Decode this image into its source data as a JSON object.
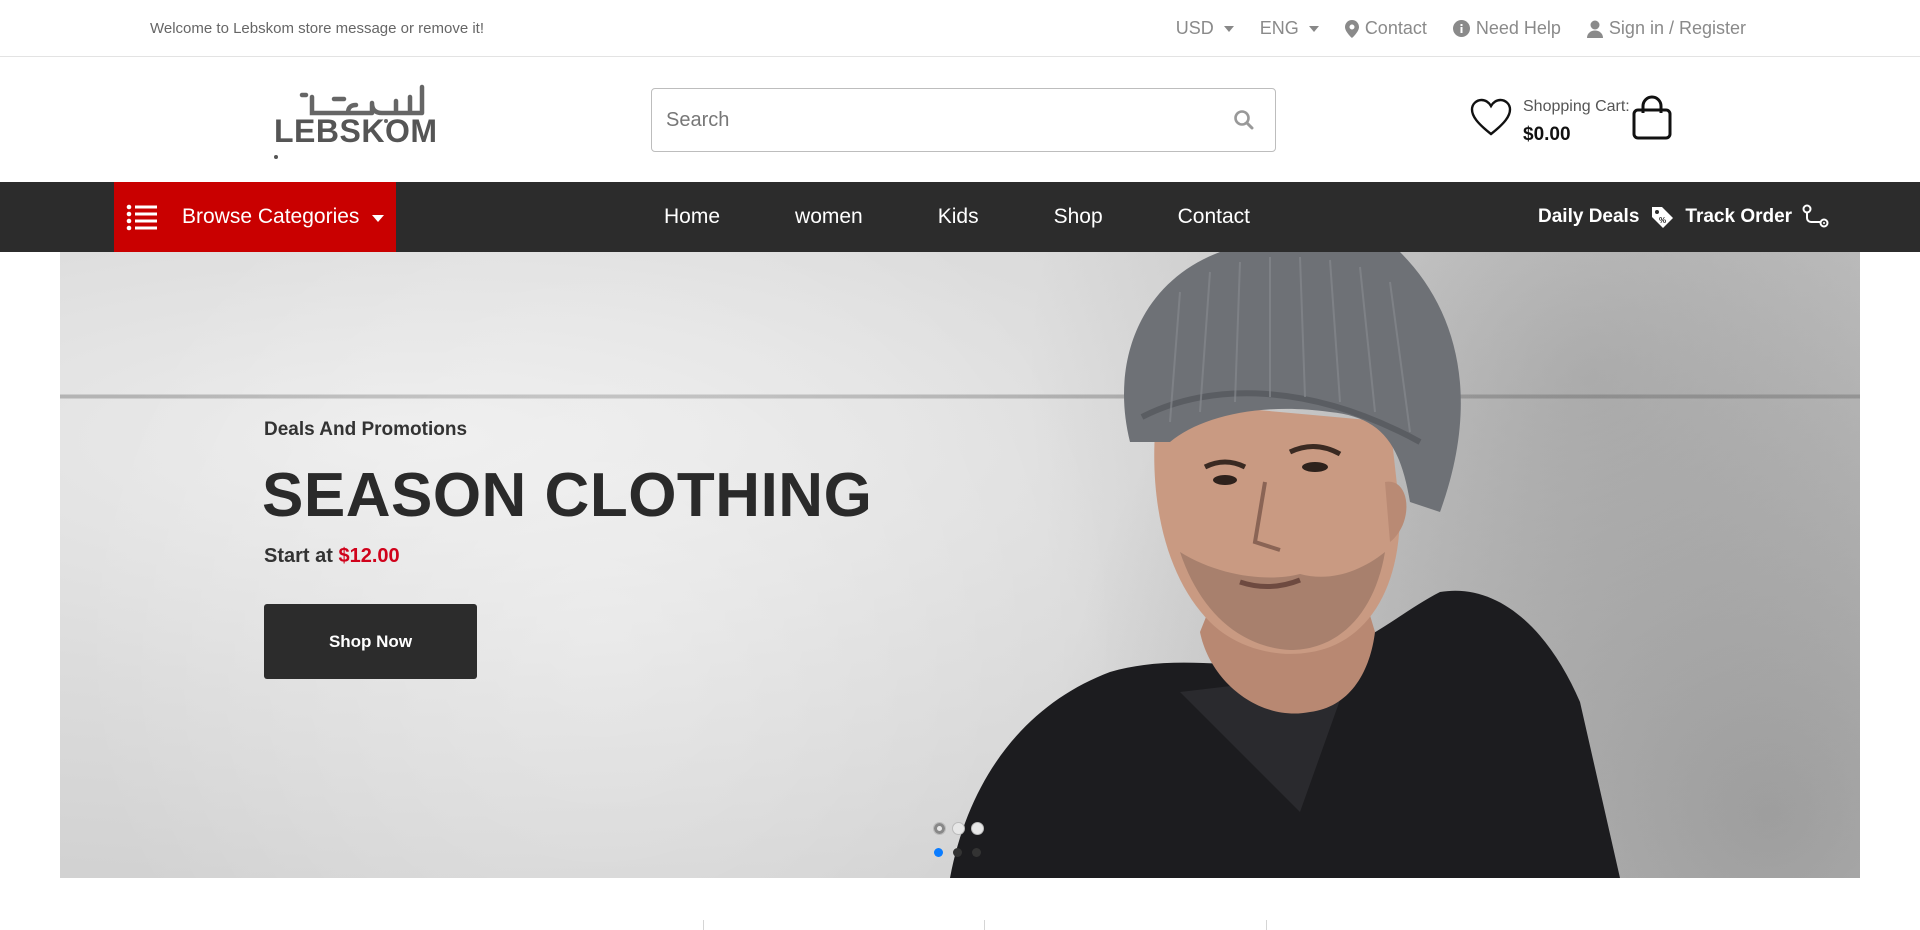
{
  "topbar": {
    "welcome": "Welcome to Lebskom store message or remove it!",
    "currency": "USD",
    "language": "ENG",
    "contact": "Contact",
    "help": "Need Help",
    "account": "Sign in / Register"
  },
  "header": {
    "logo_arabic": "لبسكم",
    "logo_text": "LEBSKOM",
    "search_placeholder": "Search",
    "cart_label": "Shopping Cart:",
    "cart_total": "$0.00"
  },
  "nav": {
    "browse": "Browse Categories",
    "links": [
      "Home",
      "women",
      "Kids",
      "Shop",
      "Contact"
    ],
    "daily_deals": "Daily Deals",
    "track_order": "Track Order"
  },
  "hero": {
    "kicker": "Deals And Promotions",
    "title": "SEASON CLOTHING",
    "price_prefix": "Start at",
    "price": "$12.00",
    "cta": "Shop Now",
    "slides": 3,
    "active_slide": 1
  },
  "colors": {
    "brand_red": "#c90000",
    "nav_bg": "#2c2c2c",
    "price_red": "#d0021b",
    "active_dot": "#0a7cff"
  }
}
